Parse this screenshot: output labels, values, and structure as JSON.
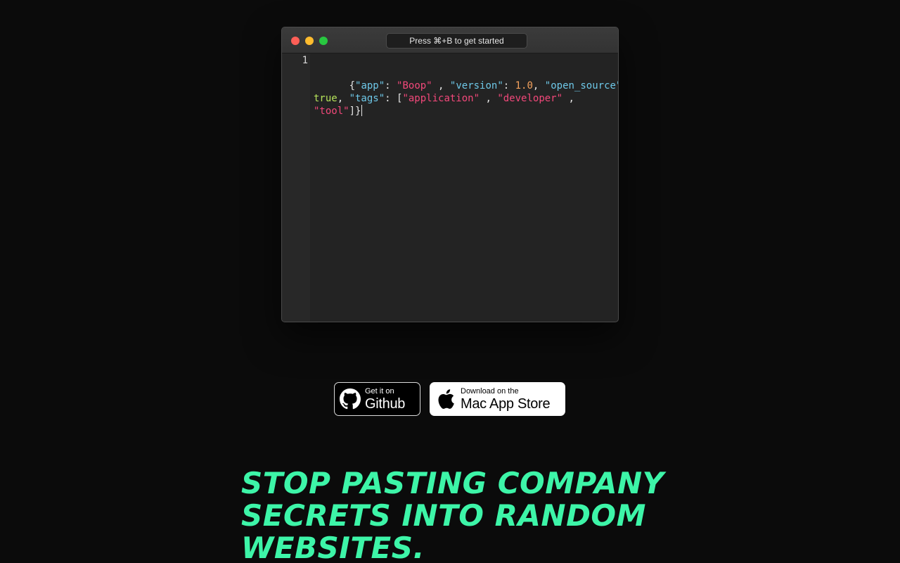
{
  "window": {
    "search_placeholder": "Press ⌘+B to get started",
    "line_number": "1"
  },
  "editor": {
    "tokens": [
      {
        "t": "{",
        "c": "punc"
      },
      {
        "t": "\"app\"",
        "c": "key"
      },
      {
        "t": ": ",
        "c": "punc"
      },
      {
        "t": "\"Boop\"",
        "c": "str"
      },
      {
        "t": " , ",
        "c": "punc"
      },
      {
        "t": "\"version\"",
        "c": "key"
      },
      {
        "t": ": ",
        "c": "punc"
      },
      {
        "t": "1.0",
        "c": "num"
      },
      {
        "t": ", ",
        "c": "punc"
      },
      {
        "t": "\"open_source\"",
        "c": "key"
      },
      {
        "t": " :\n",
        "c": "punc"
      },
      {
        "t": "true",
        "c": "bool"
      },
      {
        "t": ", ",
        "c": "punc"
      },
      {
        "t": "\"tags\"",
        "c": "key"
      },
      {
        "t": ": [",
        "c": "punc"
      },
      {
        "t": "\"application\"",
        "c": "str"
      },
      {
        "t": " , ",
        "c": "punc"
      },
      {
        "t": "\"developer\"",
        "c": "str"
      },
      {
        "t": " ,\n",
        "c": "punc"
      },
      {
        "t": "\"tool\"",
        "c": "str"
      },
      {
        "t": "]}",
        "c": "punc"
      }
    ]
  },
  "buttons": {
    "github": {
      "small": "Get it on",
      "big": "Github"
    },
    "appstore": {
      "small": "Download on the",
      "big": "Mac App Store"
    }
  },
  "headline": "STOP PASTING COMPANY SECRETS INTO RANDOM WEBSITES.",
  "colors": {
    "background": "#0b0b0b",
    "headline": "#3df5a8",
    "json_key": "#6ec8e8",
    "json_string": "#f2487a",
    "json_number": "#f5a25d",
    "json_bool": "#b6e35a"
  },
  "icons": {
    "github": "github-icon",
    "apple": "apple-icon"
  }
}
